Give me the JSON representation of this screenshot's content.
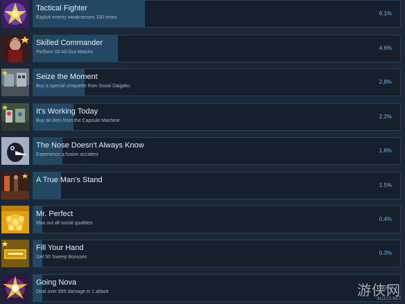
{
  "achievements": [
    {
      "title": "Tactical Fighter",
      "description": "Exploit enemy weaknesses 100 times",
      "percent": "6.1%",
      "icon": "purple-star-portrait-icon"
    },
    {
      "title": "Skilled Commander",
      "description": "Perform 50 All-Out Attacks",
      "percent": "4.6%",
      "icon": "commander-portrait-icon"
    },
    {
      "title": "Seize the Moment",
      "description": "Buy a special croquette from Sozai Daigaku",
      "percent": "2.8%",
      "icon": "street-scene-icon"
    },
    {
      "title": "It's Working Today",
      "description": "Buy an item from the Capsule Machine",
      "percent": "2.2%",
      "icon": "capsule-machine-icon"
    },
    {
      "title": "The Nose Doesn't Always Know",
      "description": "Experience a fusion accident",
      "percent": "1.6%",
      "icon": "long-nose-portrait-icon"
    },
    {
      "title": "A True Man's Stand",
      "description": "",
      "percent": "1.5%",
      "icon": "room-scene-icon"
    },
    {
      "title": "Mr. Perfect",
      "description": "Max out all social qualities",
      "percent": "0.4%",
      "icon": "status-chart-icon"
    },
    {
      "title": "Fill Your Hand",
      "description": "Get 50 Sweep Bonuses",
      "percent": "0.3%",
      "icon": "gold-banner-icon"
    },
    {
      "title": "Going Nova",
      "description": "Deal over 999 damage in 1 attack",
      "percent": "0.3%",
      "icon": "nova-burst-icon"
    }
  ],
  "colors": {
    "background": "#1b2838",
    "panel": "#16202d",
    "progress_fill": "#224864",
    "percent_text": "#7bb4e0"
  },
  "watermark": {
    "text": "游侠网",
    "url": "ALI213.NET"
  }
}
